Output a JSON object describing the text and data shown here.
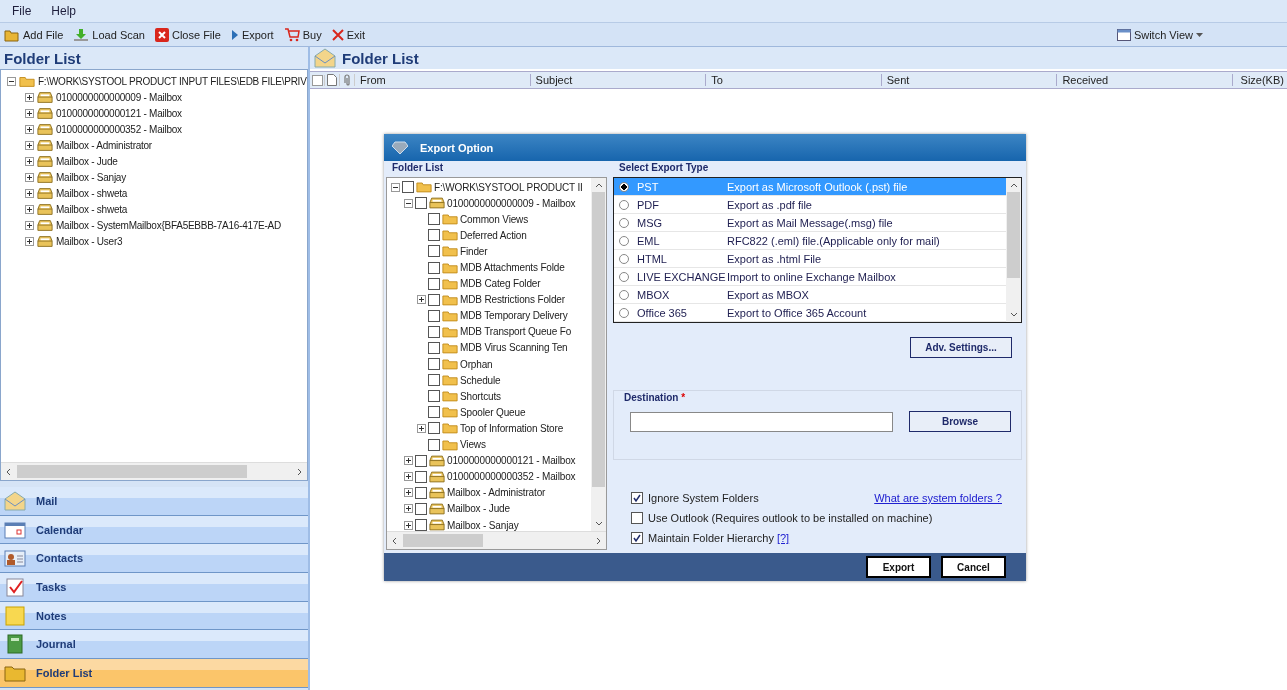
{
  "menu": [
    "File",
    "Help"
  ],
  "toolbar": [
    {
      "label": "Add File",
      "kind": "add"
    },
    {
      "label": "Load Scan",
      "kind": "load"
    },
    {
      "label": "Close File",
      "kind": "close"
    },
    {
      "label": "Export",
      "kind": "export"
    },
    {
      "label": "Buy",
      "kind": "buy"
    },
    {
      "label": "Exit",
      "kind": "exit"
    }
  ],
  "switch_view": "Switch View",
  "left": {
    "title": "Folder List",
    "tree": [
      {
        "label": "F:\\WORK\\SYSTOOL PRODUCT INPUT FILES\\EDB FILE\\PRIV",
        "kind": "folder",
        "expanded": true,
        "children": [
          {
            "label": "0100000000000009 - Mailbox",
            "kind": "mailbox",
            "expanded": false
          },
          {
            "label": "0100000000000121 - Mailbox",
            "kind": "mailbox",
            "expanded": false
          },
          {
            "label": "0100000000000352 - Mailbox",
            "kind": "mailbox",
            "expanded": false
          },
          {
            "label": "Mailbox - Administrator",
            "kind": "mailbox",
            "expanded": false
          },
          {
            "label": "Mailbox - Jude",
            "kind": "mailbox",
            "expanded": false
          },
          {
            "label": "Mailbox - Sanjay",
            "kind": "mailbox",
            "expanded": false
          },
          {
            "label": "Mailbox - shweta",
            "kind": "mailbox",
            "expanded": false
          },
          {
            "label": "Mailbox - shweta",
            "kind": "mailbox",
            "expanded": false
          },
          {
            "label": "Mailbox - SystemMailbox{BFA5EBBB-7A16-417E-AD",
            "kind": "mailbox",
            "expanded": false
          },
          {
            "label": "Mailbox - User3",
            "kind": "mailbox",
            "expanded": false
          }
        ]
      }
    ]
  },
  "nav": [
    {
      "label": "Mail",
      "kind": "mail",
      "selected": false
    },
    {
      "label": "Calendar",
      "kind": "calendar",
      "selected": false
    },
    {
      "label": "Contacts",
      "kind": "contacts",
      "selected": false
    },
    {
      "label": "Tasks",
      "kind": "tasks",
      "selected": false
    },
    {
      "label": "Notes",
      "kind": "notes",
      "selected": false
    },
    {
      "label": "Journal",
      "kind": "journal",
      "selected": false
    },
    {
      "label": "Folder List",
      "kind": "folder",
      "selected": true
    }
  ],
  "right": {
    "title": "Folder List",
    "columns": [
      "From",
      "Subject",
      "To",
      "Sent",
      "Received",
      "Size(KB)"
    ]
  },
  "dialog": {
    "title": "Export Option",
    "folder_list_label": "Folder List",
    "tree": [
      {
        "label": "F:\\WORK\\SYSTOOL PRODUCT II",
        "kind": "folder",
        "expanded": true,
        "checked": false,
        "children": [
          {
            "label": "0100000000000009 - Mailbox",
            "kind": "mailbox",
            "expanded": true,
            "checked": false,
            "children": [
              {
                "label": "Common Views",
                "kind": "folder",
                "checked": false
              },
              {
                "label": "Deferred Action",
                "kind": "folder",
                "checked": false
              },
              {
                "label": "Finder",
                "kind": "folder",
                "checked": false
              },
              {
                "label": "MDB Attachments Folde",
                "kind": "folder",
                "checked": false
              },
              {
                "label": "MDB Categ Folder",
                "kind": "folder",
                "checked": false
              },
              {
                "label": "MDB Restrictions Folder",
                "kind": "folder",
                "expanded": false,
                "checked": false
              },
              {
                "label": "MDB Temporary Delivery",
                "kind": "folder",
                "checked": false
              },
              {
                "label": "MDB Transport Queue Fo",
                "kind": "folder",
                "checked": false
              },
              {
                "label": "MDB Virus Scanning Ten",
                "kind": "folder",
                "checked": false
              },
              {
                "label": "Orphan",
                "kind": "folder",
                "checked": false
              },
              {
                "label": "Schedule",
                "kind": "folder",
                "checked": false
              },
              {
                "label": "Shortcuts",
                "kind": "folder",
                "checked": false
              },
              {
                "label": "Spooler Queue",
                "kind": "folder",
                "checked": false
              },
              {
                "label": "Top of Information Store",
                "kind": "folder",
                "expanded": false,
                "checked": false
              },
              {
                "label": "Views",
                "kind": "folder",
                "checked": false
              }
            ]
          },
          {
            "label": "0100000000000121 - Mailbox",
            "kind": "mailbox",
            "expanded": false,
            "checked": false
          },
          {
            "label": "0100000000000352 - Mailbox",
            "kind": "mailbox",
            "expanded": false,
            "checked": false
          },
          {
            "label": "Mailbox - Administrator",
            "kind": "mailbox",
            "expanded": false,
            "checked": false
          },
          {
            "label": "Mailbox - Jude",
            "kind": "mailbox",
            "expanded": false,
            "checked": false
          },
          {
            "label": "Mailbox - Sanjay",
            "kind": "mailbox",
            "expanded": false,
            "checked": false
          }
        ]
      }
    ],
    "export_type_label": "Select Export Type",
    "export_types": [
      {
        "name": "PST",
        "description": "Export as Microsoft Outlook (.pst) file",
        "selected": true
      },
      {
        "name": "PDF",
        "description": "Export as .pdf file",
        "selected": false
      },
      {
        "name": "MSG",
        "description": "Export as Mail Message(.msg) file",
        "selected": false
      },
      {
        "name": "EML",
        "description": "RFC822 (.eml) file.(Applicable only for mail)",
        "selected": false
      },
      {
        "name": "HTML",
        "description": "Export as .html File",
        "selected": false
      },
      {
        "name": "LIVE EXCHANGE",
        "description": "Import to online Exchange Mailbox",
        "selected": false
      },
      {
        "name": "MBOX",
        "description": "Export as MBOX",
        "selected": false
      },
      {
        "name": "Office 365",
        "description": "Export to Office 365 Account",
        "selected": false
      }
    ],
    "adv_settings": "Adv. Settings...",
    "destination_label": "Destination",
    "destination_required": "*",
    "browse": "Browse",
    "options": [
      {
        "label": "Ignore System Folders",
        "checked": true,
        "link": "What are system folders ?"
      },
      {
        "label": "Use Outlook (Requires outlook to be installed on machine)",
        "checked": false
      },
      {
        "label": "Maintain Folder Hierarchy",
        "checked": true,
        "help": "[?]"
      }
    ],
    "export": "Export",
    "cancel": "Cancel"
  }
}
